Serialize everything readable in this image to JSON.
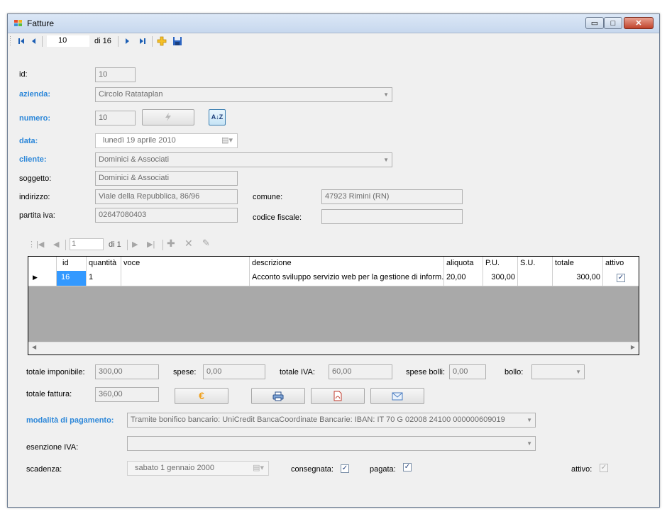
{
  "window": {
    "title": "Fatture",
    "min_glyph": "▭",
    "max_glyph": "□",
    "close_glyph": "✕"
  },
  "toolbar": {
    "position": "10",
    "count": "di 16"
  },
  "form": {
    "id_label": "id:",
    "id_value": "10",
    "azienda_label": "azienda:",
    "azienda_value": "Circolo Ratataplan",
    "numero_label": "numero:",
    "numero_value": "10",
    "data_label": "data:",
    "data_value": "lunedì   19   aprile   2010",
    "cliente_label": "cliente:",
    "cliente_value": "Dominici & Associati",
    "soggetto_label": "soggetto:",
    "soggetto_value": "Dominici & Associati",
    "indirizzo_label": "indirizzo:",
    "indirizzo_value": "Viale della Repubblica, 86/96",
    "comune_label": "comune:",
    "comune_value": "47923 Rimini (RN)",
    "piva_label": "partita iva:",
    "piva_value": "02647080403",
    "cf_label": "codice fiscale:",
    "cf_value": ""
  },
  "detail_nav": {
    "position": "1",
    "count": "di 1"
  },
  "grid": {
    "columns": [
      "id",
      "quantità",
      "voce",
      "descrizione",
      "aliquota",
      "P.U.",
      "S.U.",
      "totale",
      "attivo"
    ],
    "rows": [
      {
        "id": "16",
        "quantita": "1",
        "voce": "",
        "descrizione": "Acconto sviluppo servizio web per la gestione di inform...",
        "aliquota": "20,00",
        "pu": "300,00",
        "su": "",
        "totale": "300,00",
        "attivo": true
      }
    ]
  },
  "totals": {
    "imponibile_label": "totale imponibile:",
    "imponibile_value": "300,00",
    "spese_label": "spese:",
    "spese_value": "0,00",
    "iva_label": "totale IVA:",
    "iva_value": "60,00",
    "bolli_label": "spese bolli:",
    "bolli_value": "0,00",
    "bollo_label": "bollo:",
    "bollo_value": "",
    "fattura_label": "totale fattura:",
    "fattura_value": "360,00"
  },
  "payment": {
    "modalita_label": "modalità di pagamento:",
    "modalita_value": "Tramite bonifico bancario: UniCredit BancaCoordinate Bancarie: IBAN: IT 70 G 02008 24100 000000609019",
    "esenzione_label": "esenzione IVA:",
    "esenzione_value": "",
    "scadenza_label": "scadenza:",
    "scadenza_value": "sabato     1  gennaio  2000",
    "consegnata_label": "consegnata:",
    "consegnata_checked": true,
    "pagata_label": "pagata:",
    "pagata_checked": true,
    "attivo_label": "attivo:",
    "attivo_checked": true
  },
  "buttons": {
    "euro_glyph": "€",
    "sort_glyph": "A↓Z"
  },
  "colors": {
    "accent_label": "#2c87d9",
    "selection": "#3399ff",
    "grid_background": "#a9a9a9"
  }
}
